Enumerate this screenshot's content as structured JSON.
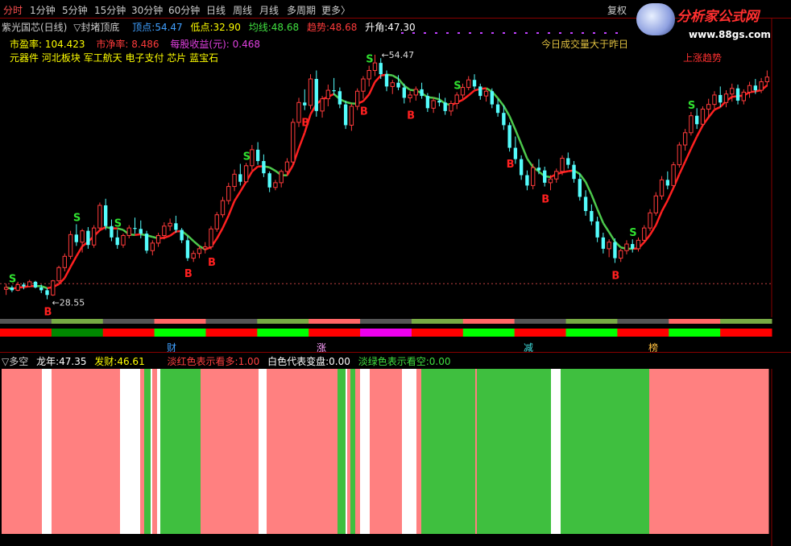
{
  "toolbar": {
    "periods": [
      "分时",
      "1分钟",
      "5分钟",
      "15分钟",
      "30分钟",
      "60分钟",
      "日线",
      "周线",
      "月线",
      "多周期",
      "更多〉"
    ],
    "restore": "复权",
    "logo_text": "分析家公式网",
    "logo_url": "www.88gs.com"
  },
  "header": {
    "stock_name": "紫光国芯(日线)",
    "indicator": "▽封堵顶底",
    "peak_label": "顶点:",
    "peak_value": "54.47",
    "low_label": "低点:",
    "low_value": "32.90",
    "avg_label": "均线:",
    "avg_value": "48.68",
    "trend_label": "趋势:",
    "trend_value": "48.68",
    "angle_label": "升角:",
    "angle_value": "47.30"
  },
  "info": {
    "pe_label": "市盈率:",
    "pe_value": "104.423",
    "pb_label": "市净率:",
    "pb_value": "8.486",
    "eps_label": "每股收益(元):",
    "eps_value": "0.468",
    "sectors": "元器件 河北板块 军工航天 电子支付 芯片 蓝宝石",
    "note1": "今日成交量大于昨日",
    "note2": "上涨趋势"
  },
  "markers": {
    "high_label": "54.47",
    "low_label": "28.55",
    "buy": "B",
    "sell": "S"
  },
  "strip_labels": [
    "财",
    "涨",
    "减",
    "榜"
  ],
  "lower": {
    "title": "▽多空",
    "dragon_label": "龙年:",
    "dragon_value": "47.35",
    "fortune_label": "发财:",
    "fortune_value": "46.61",
    "legend_red": "淡红色表示看多:",
    "legend_red_value": "1.00",
    "legend_white": "白色代表变盘:",
    "legend_white_value": "0.00",
    "legend_green": "淡绿色表示看空:",
    "legend_green_value": "0.00"
  },
  "colors": {
    "up": "#ff3b3b",
    "down": "#54fcfc",
    "trend_up": "#ff2020",
    "trend_down": "#4cc94c",
    "bull": "#ff8080",
    "bear": "#3fbf3f",
    "neutral": "#ffffff"
  },
  "chart_data": {
    "type": "candlestick",
    "series_trend": "trend line colored red in uptrend, green in downtrend",
    "ylim": [
      28,
      56
    ],
    "candles": [
      [
        29.6,
        30.2,
        29.0,
        29.8
      ],
      [
        29.8,
        30.0,
        29.3,
        29.5
      ],
      [
        29.5,
        30.4,
        29.4,
        30.1
      ],
      [
        30.1,
        30.3,
        29.6,
        29.9
      ],
      [
        29.9,
        30.6,
        29.8,
        30.4
      ],
      [
        30.4,
        30.5,
        29.7,
        29.8
      ],
      [
        29.8,
        30.1,
        29.2,
        29.5
      ],
      [
        29.5,
        29.7,
        28.55,
        29.0
      ],
      [
        29.0,
        30.6,
        28.9,
        30.5
      ],
      [
        30.5,
        32.1,
        30.3,
        31.9
      ],
      [
        31.9,
        33.4,
        31.5,
        33.1
      ],
      [
        33.1,
        35.8,
        32.8,
        35.4
      ],
      [
        35.4,
        36.5,
        34.2,
        34.6
      ],
      [
        34.6,
        36.0,
        33.5,
        35.8
      ],
      [
        35.8,
        36.2,
        33.9,
        34.3
      ],
      [
        34.3,
        36.4,
        34.0,
        36.1
      ],
      [
        36.1,
        38.8,
        35.8,
        38.5
      ],
      [
        38.5,
        39.2,
        35.9,
        36.3
      ],
      [
        36.3,
        37.0,
        34.7,
        35.1
      ],
      [
        35.1,
        35.9,
        33.9,
        34.3
      ],
      [
        34.3,
        35.5,
        34.0,
        35.3
      ],
      [
        35.3,
        36.4,
        35.0,
        36.1
      ],
      [
        36.1,
        37.2,
        35.5,
        36.0
      ],
      [
        36.0,
        36.9,
        35.0,
        35.5
      ],
      [
        35.5,
        35.8,
        33.4,
        33.7
      ],
      [
        33.7,
        34.8,
        33.2,
        34.5
      ],
      [
        34.5,
        35.6,
        34.1,
        35.3
      ],
      [
        35.3,
        36.7,
        34.9,
        36.3
      ],
      [
        36.3,
        37.1,
        35.8,
        36.6
      ],
      [
        36.6,
        37.4,
        35.6,
        35.9
      ],
      [
        35.9,
        36.1,
        34.5,
        34.8
      ],
      [
        34.8,
        35.3,
        32.6,
        32.9
      ],
      [
        32.9,
        33.7,
        32.5,
        33.4
      ],
      [
        33.4,
        34.2,
        32.9,
        33.9
      ],
      [
        33.9,
        34.6,
        33.4,
        34.1
      ],
      [
        34.1,
        36.3,
        33.8,
        36.0
      ],
      [
        36.0,
        37.8,
        35.7,
        37.5
      ],
      [
        37.5,
        39.4,
        37.2,
        39.0
      ],
      [
        39.0,
        40.9,
        38.6,
        40.5
      ],
      [
        40.5,
        42.3,
        40.0,
        41.8
      ],
      [
        41.8,
        42.9,
        40.6,
        41.0
      ],
      [
        41.0,
        43.0,
        40.9,
        42.7
      ],
      [
        42.7,
        44.9,
        42.2,
        44.4
      ],
      [
        44.4,
        45.2,
        42.8,
        43.2
      ],
      [
        43.2,
        43.9,
        41.5,
        41.9
      ],
      [
        41.9,
        42.1,
        39.9,
        40.4
      ],
      [
        40.4,
        41.2,
        40.1,
        40.9
      ],
      [
        40.9,
        42.3,
        40.4,
        42.1
      ],
      [
        42.1,
        43.5,
        41.6,
        43.1
      ],
      [
        43.1,
        47.7,
        42.8,
        47.3
      ],
      [
        47.3,
        49.9,
        46.8,
        49.4
      ],
      [
        49.4,
        50.8,
        48.6,
        49.1
      ],
      [
        49.1,
        52.4,
        48.7,
        51.9
      ],
      [
        51.9,
        52.8,
        47.9,
        48.5
      ],
      [
        48.5,
        50.1,
        47.8,
        49.8
      ],
      [
        49.8,
        51.3,
        49.0,
        50.7
      ],
      [
        50.7,
        52.0,
        50.2,
        50.6
      ],
      [
        50.6,
        51.0,
        48.8,
        49.2
      ],
      [
        49.2,
        49.6,
        46.6,
        47.0
      ],
      [
        47.0,
        49.3,
        46.4,
        49.0
      ],
      [
        49.0,
        50.9,
        48.6,
        50.6
      ],
      [
        50.6,
        52.2,
        49.8,
        51.9
      ],
      [
        51.9,
        53.3,
        51.1,
        52.8
      ],
      [
        52.8,
        54.47,
        52.2,
        53.6
      ],
      [
        53.6,
        54.1,
        51.9,
        52.4
      ],
      [
        52.4,
        52.8,
        50.6,
        51.1
      ],
      [
        51.1,
        51.8,
        50.3,
        51.5
      ],
      [
        51.5,
        52.3,
        50.7,
        51.0
      ],
      [
        51.0,
        51.4,
        49.3,
        49.9
      ],
      [
        49.9,
        50.6,
        49.4,
        50.2
      ],
      [
        50.2,
        51.1,
        49.6,
        50.8
      ],
      [
        50.8,
        51.5,
        49.8,
        50.1
      ],
      [
        50.1,
        50.4,
        48.4,
        48.8
      ],
      [
        48.8,
        49.9,
        48.3,
        49.6
      ],
      [
        49.6,
        50.4,
        49.0,
        49.4
      ],
      [
        49.4,
        49.9,
        48.1,
        48.5
      ],
      [
        48.5,
        49.6,
        48.0,
        49.3
      ],
      [
        49.3,
        50.5,
        48.7,
        50.2
      ],
      [
        50.2,
        51.4,
        49.8,
        51.0
      ],
      [
        51.0,
        52.2,
        50.7,
        51.8
      ],
      [
        51.8,
        52.4,
        50.8,
        51.1
      ],
      [
        51.1,
        51.4,
        49.7,
        50.1
      ],
      [
        50.1,
        50.9,
        49.5,
        50.6
      ],
      [
        50.6,
        50.9,
        48.8,
        49.2
      ],
      [
        49.2,
        49.8,
        47.9,
        48.3
      ],
      [
        48.3,
        49.1,
        46.5,
        47.0
      ],
      [
        47.0,
        47.3,
        44.2,
        44.6
      ],
      [
        44.6,
        45.8,
        42.9,
        43.4
      ],
      [
        43.4,
        43.8,
        41.2,
        41.7
      ],
      [
        41.7,
        42.2,
        40.1,
        40.6
      ],
      [
        40.6,
        42.9,
        40.2,
        42.5
      ],
      [
        42.5,
        43.4,
        41.8,
        42.2
      ],
      [
        42.2,
        42.6,
        40.5,
        40.9
      ],
      [
        40.9,
        41.7,
        40.1,
        41.3
      ],
      [
        41.3,
        42.4,
        40.9,
        42.1
      ],
      [
        42.1,
        43.8,
        41.7,
        43.5
      ],
      [
        43.5,
        44.1,
        42.4,
        42.8
      ],
      [
        42.8,
        43.2,
        40.9,
        41.3
      ],
      [
        41.3,
        41.9,
        39.0,
        39.4
      ],
      [
        39.4,
        40.1,
        37.4,
        37.9
      ],
      [
        37.9,
        38.6,
        36.4,
        36.8
      ],
      [
        36.8,
        37.3,
        34.6,
        35.1
      ],
      [
        35.1,
        35.6,
        33.4,
        33.9
      ],
      [
        33.9,
        34.9,
        33.0,
        34.6
      ],
      [
        34.6,
        35.0,
        32.4,
        32.9
      ],
      [
        32.9,
        33.9,
        32.5,
        33.7
      ],
      [
        33.7,
        34.8,
        33.3,
        34.4
      ],
      [
        34.4,
        34.9,
        33.5,
        33.9
      ],
      [
        33.9,
        35.1,
        33.6,
        34.8
      ],
      [
        34.8,
        36.4,
        34.6,
        36.1
      ],
      [
        36.1,
        38.1,
        35.8,
        37.7
      ],
      [
        37.7,
        39.9,
        37.4,
        39.5
      ],
      [
        39.5,
        41.6,
        39.1,
        41.2
      ],
      [
        41.2,
        42.1,
        40.2,
        40.6
      ],
      [
        40.6,
        43.1,
        40.4,
        42.8
      ],
      [
        42.8,
        45.2,
        42.5,
        44.9
      ],
      [
        44.9,
        46.6,
        44.3,
        46.2
      ],
      [
        46.2,
        48.4,
        45.9,
        48.0
      ],
      [
        48.0,
        48.8,
        46.6,
        47.1
      ],
      [
        47.1,
        49.0,
        46.9,
        48.7
      ],
      [
        48.7,
        49.8,
        47.8,
        49.2
      ],
      [
        49.2,
        50.6,
        48.7,
        50.2
      ],
      [
        50.2,
        51.1,
        48.9,
        49.4
      ],
      [
        49.4,
        50.7,
        48.9,
        50.3
      ],
      [
        50.3,
        51.4,
        49.5,
        50.9
      ],
      [
        50.9,
        51.3,
        49.2,
        49.6
      ],
      [
        49.6,
        50.8,
        49.2,
        50.5
      ],
      [
        50.5,
        51.6,
        49.9,
        51.2
      ],
      [
        51.2,
        51.9,
        50.3,
        50.7
      ],
      [
        50.7,
        52.0,
        50.4,
        51.6
      ],
      [
        51.6,
        52.8,
        51.1,
        52.1
      ]
    ],
    "buy_signal_indices": [
      7,
      31,
      35,
      51,
      61,
      69,
      86,
      92,
      104
    ],
    "sell_signal_indices": [
      1,
      12,
      19,
      41,
      62,
      77,
      107,
      117
    ]
  },
  "strip": {
    "row1": [
      "#555",
      "#7a4",
      "#555",
      "#f66",
      "#555",
      "#7a4",
      "#f66",
      "#555",
      "#7a4",
      "#f66",
      "#555",
      "#7a4",
      "#555",
      "#f66",
      "#7a4"
    ],
    "row2": [
      "#f00",
      "#080",
      "#f00",
      "#0f0",
      "#f00",
      "#0f0",
      "#f00",
      "#e0e",
      "#f00",
      "#0f0",
      "#f00",
      "#0f0",
      "#f00",
      "#0f0",
      "#f00"
    ]
  },
  "bands": [
    [
      "#ff8080",
      50
    ],
    [
      "#ffffff",
      12
    ],
    [
      "#ff8080",
      85
    ],
    [
      "#ffffff",
      25
    ],
    [
      "#ff8080",
      5
    ],
    [
      "#3fbf3f",
      8
    ],
    [
      "#ffffff",
      2
    ],
    [
      "#ff8080",
      6
    ],
    [
      "#ffffff",
      4
    ],
    [
      "#3fbf3f",
      50
    ],
    [
      "#ff8080",
      72
    ],
    [
      "#ffffff",
      10
    ],
    [
      "#ff8080",
      88
    ],
    [
      "#3fbf3f",
      10
    ],
    [
      "#ffffff",
      2
    ],
    [
      "#ff8080",
      4
    ],
    [
      "#3fbf3f",
      6
    ],
    [
      "#ff8080",
      6
    ],
    [
      "#ffffff",
      12
    ],
    [
      "#ff8080",
      40
    ],
    [
      "#ffffff",
      18
    ],
    [
      "#ff8080",
      6
    ],
    [
      "#3fbf3f",
      67
    ],
    [
      "#ff8080",
      2
    ],
    [
      "#3fbf3f",
      92
    ],
    [
      "#ffffff",
      12
    ],
    [
      "#3fbf3f",
      110
    ],
    [
      "#ff8080",
      148
    ]
  ]
}
